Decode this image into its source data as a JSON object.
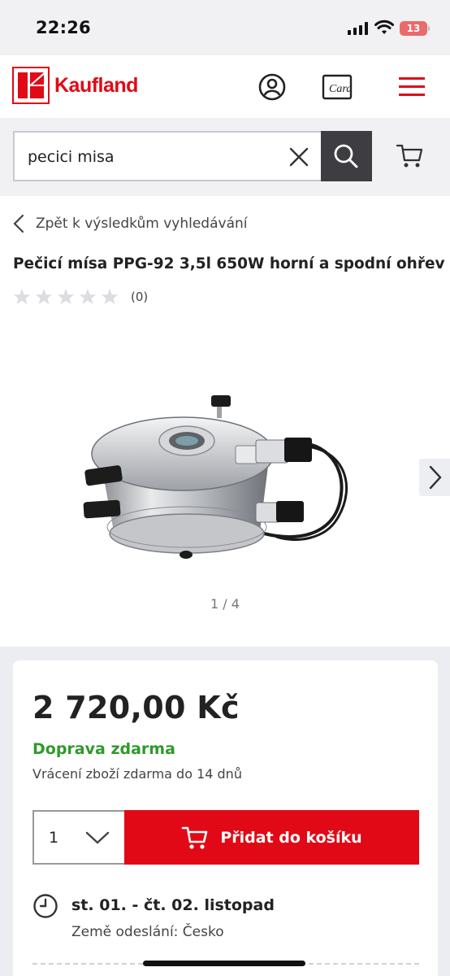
{
  "status_bar": {
    "time": "22:26",
    "battery": "13"
  },
  "header": {
    "brand": "Kaufland",
    "card_label": "Card"
  },
  "search": {
    "value": "pecici misa"
  },
  "breadcrumb": {
    "back_label": "Zpět k výsledkům vyhledávání"
  },
  "product": {
    "title": "Pečicí mísa PPG-92 3,5l 650W horní a spodní ohřev",
    "rating_stars": 0,
    "rating_count": "(0)",
    "gallery_pager": "1 / 4"
  },
  "pricing": {
    "price": "2 720,00 Kč",
    "shipping": "Doprava zdarma",
    "returns": "Vrácení zboží zdarma do 14 dnů",
    "quantity": "1",
    "add_to_cart_label": "Přidat do košíku",
    "delivery_date": "st. 01. - čt. 02. listopad",
    "origin": "Země odeslání: Česko"
  },
  "colors": {
    "brand_red": "#e10915",
    "shipping_green": "#2e9a2a",
    "search_button": "#3d3d42"
  },
  "icons": [
    "account-icon",
    "card-icon",
    "menu-icon",
    "clear-icon",
    "search-icon",
    "cart-icon",
    "back-chevron-icon",
    "star-icon",
    "next-arrow-icon",
    "chevron-down-icon",
    "clock-icon"
  ]
}
